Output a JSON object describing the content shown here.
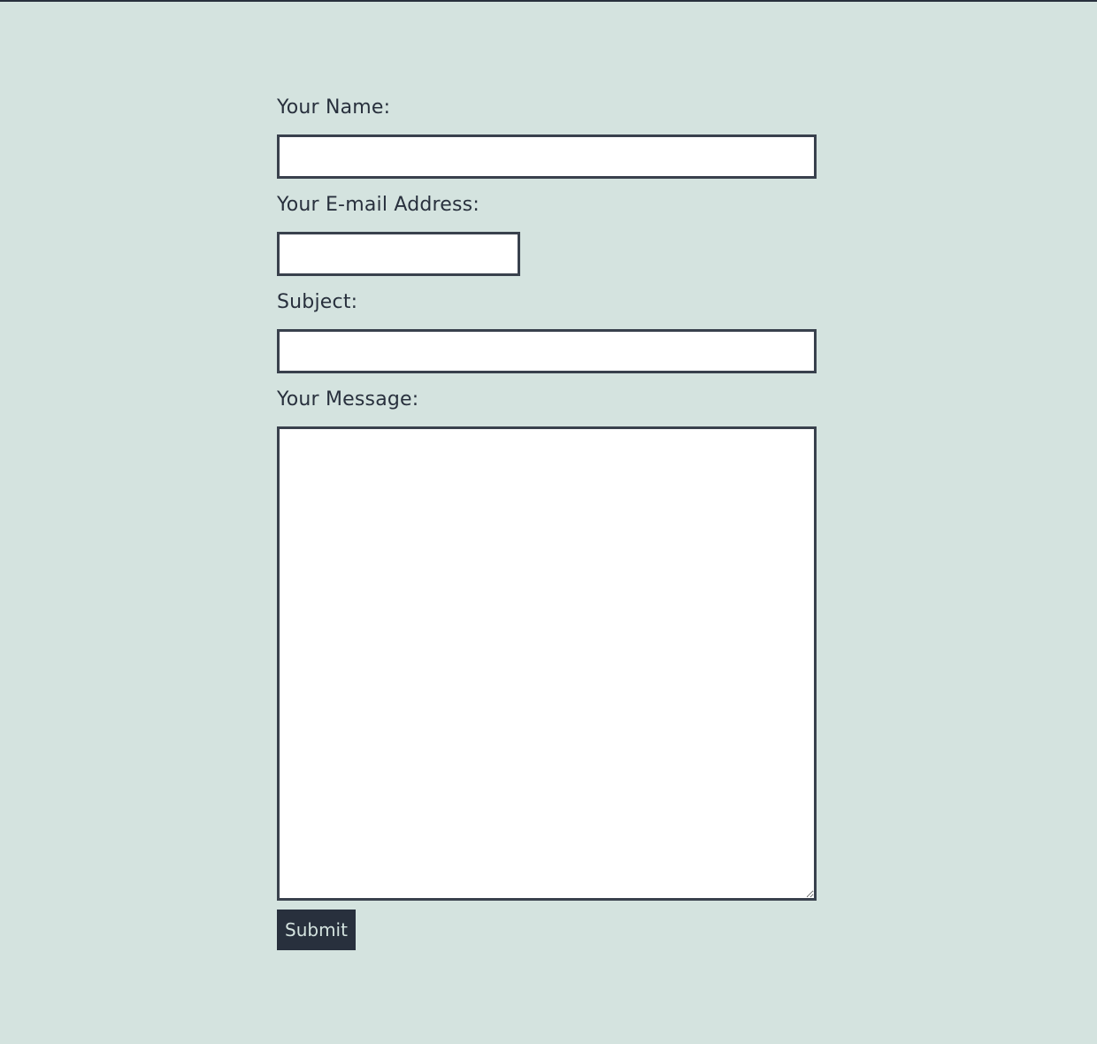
{
  "form": {
    "name_label": "Your Name:",
    "name_value": "",
    "email_label": "Your E-mail Address:",
    "email_value": "",
    "subject_label": "Subject:",
    "subject_value": "",
    "message_label": "Your Message:",
    "message_value": "",
    "submit_label": "Submit"
  },
  "colors": {
    "background": "#d4e3df",
    "text": "#28303d",
    "field_border": "#39414d",
    "field_background": "#ffffff",
    "button_background": "#28303d",
    "button_text": "#d4e3df"
  }
}
